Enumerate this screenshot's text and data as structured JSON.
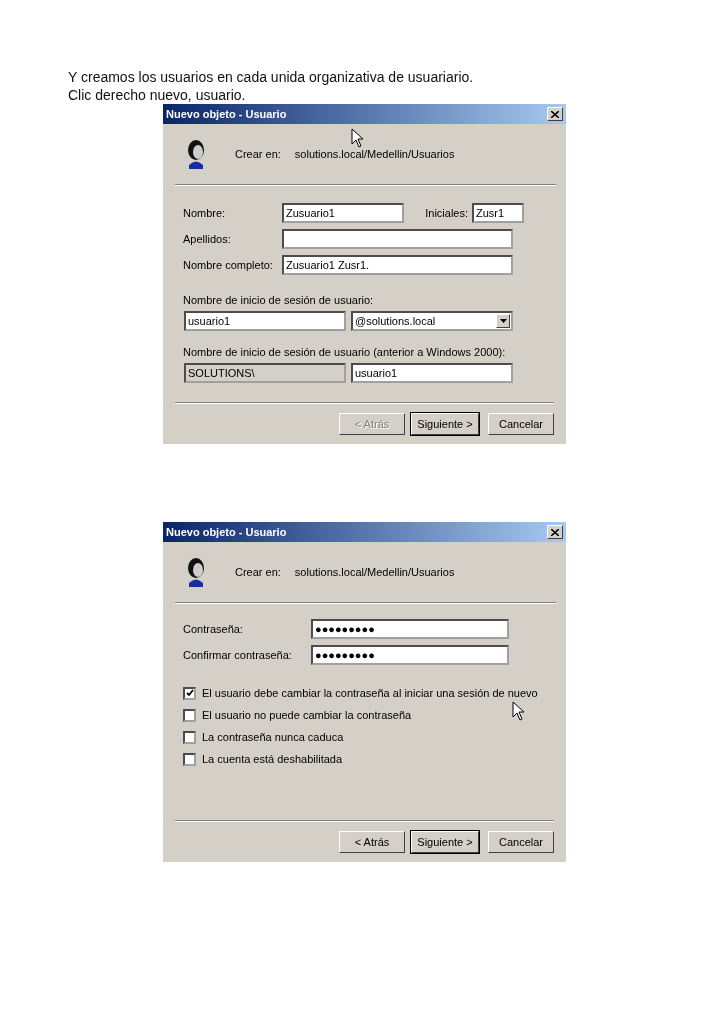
{
  "intro": [
    "Y creamos los usuarios en cada unida organizativa de usuariario.",
    "Clic derecho nuevo, usuario."
  ],
  "dialogs": [
    {
      "kind": "names",
      "title": "Nuevo objeto - Usuario",
      "create_label": "Crear en:",
      "create_path": "solutions.local/Medellin/Usuarios",
      "first_name": {
        "label": "Nombre:",
        "value": "Zusuario1"
      },
      "initials": {
        "label": "Iniciales:",
        "value": "Zusr1"
      },
      "last_name": {
        "label": "Apellidos:"
      },
      "full_name": {
        "label": "Nombre completo:",
        "value": "Zusuario1 Zusr1."
      },
      "logon": {
        "label": "Nombre de inicio de sesión de usuario:",
        "value": "usuario1",
        "domain": "@solutions.local"
      },
      "legacy_logon": {
        "label": "Nombre de inicio de sesión de usuario (anterior a Windows 2000):",
        "domain": "SOLUTIONS\\",
        "value": "usuario1"
      },
      "buttons": [
        {
          "label": "< Atrás",
          "disabled": true,
          "default": false
        },
        {
          "label": "Siguiente >",
          "disabled": false,
          "default": true
        },
        {
          "label": "Cancelar",
          "disabled": false,
          "default": false
        }
      ]
    },
    {
      "kind": "password",
      "title": "Nuevo objeto - Usuario",
      "create_label": "Crear en:",
      "create_path": "solutions.local/Medellin/Usuarios",
      "password": {
        "label": "Contraseña:",
        "value": "●●●●●●●●●"
      },
      "confirm": {
        "label": "Confirmar contraseña:",
        "value": "●●●●●●●●●"
      },
      "options": [
        {
          "label": "El usuario debe cambiar la contraseña al iniciar una sesión de nuevo",
          "checked": true
        },
        {
          "label": "El usuario no puede cambiar la contraseña",
          "checked": false
        },
        {
          "label": "La contraseña nunca caduca",
          "checked": false
        },
        {
          "label": "La cuenta está deshabilitada",
          "checked": false
        }
      ],
      "buttons": [
        {
          "label": "< Atrás",
          "disabled": false,
          "default": false
        },
        {
          "label": "Siguiente >",
          "disabled": false,
          "default": true
        },
        {
          "label": "Cancelar",
          "disabled": false,
          "default": false
        }
      ]
    }
  ]
}
